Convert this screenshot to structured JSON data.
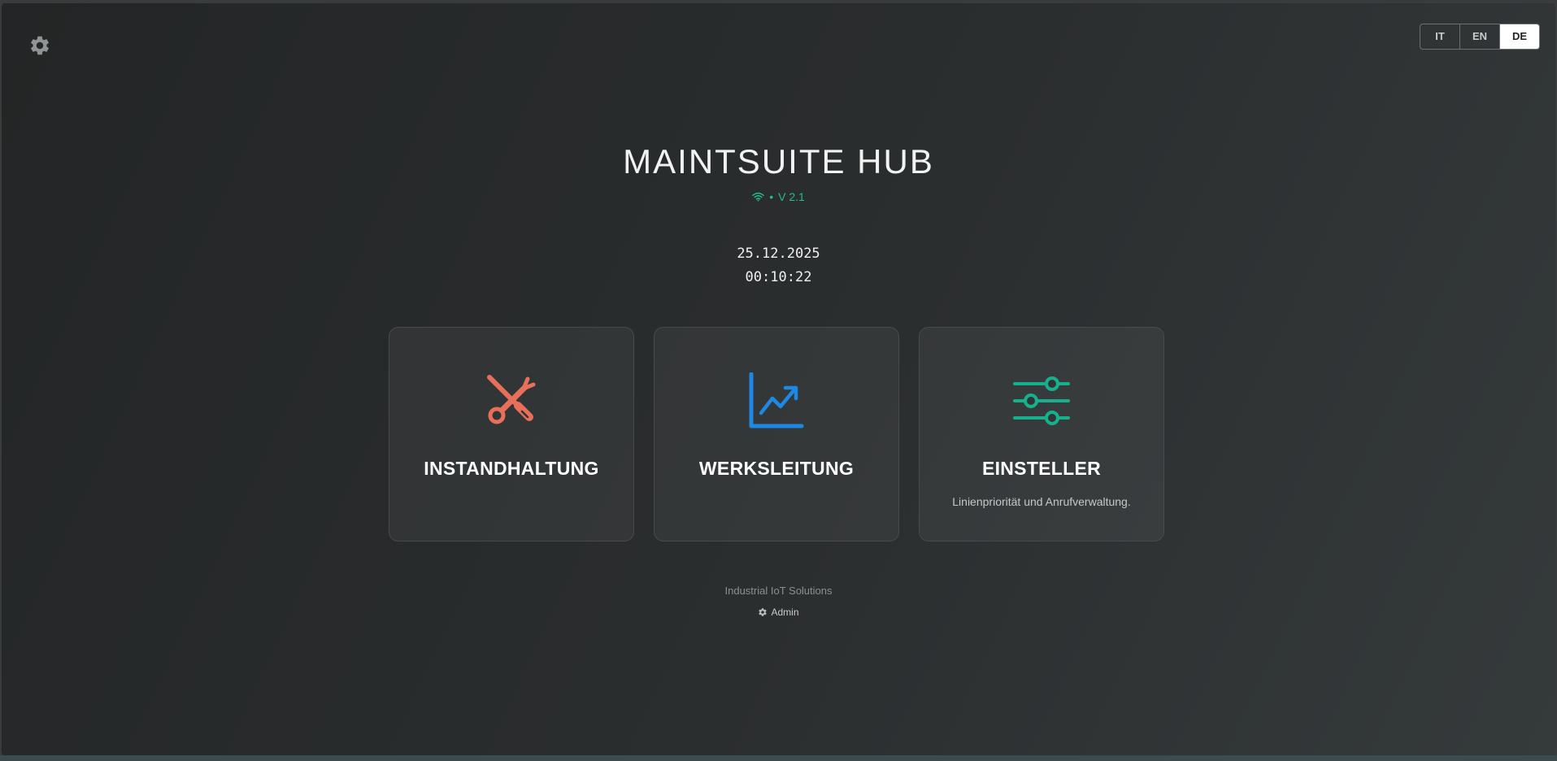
{
  "header": {
    "title": "MAINTSUITE HUB",
    "status_separator": "•",
    "version": "V 2.1"
  },
  "clock": {
    "date": "25.12.2025",
    "time": "00:10:22"
  },
  "language": {
    "options": [
      "IT",
      "EN",
      "DE"
    ],
    "selected": "DE"
  },
  "cards": [
    {
      "title": "INSTANDHALTUNG",
      "description": "",
      "icon": "tools-icon",
      "color": "#e8705a"
    },
    {
      "title": "WERKSLEITUNG",
      "description": "",
      "icon": "chart-line-icon",
      "color": "#1e88e5"
    },
    {
      "title": "EINSTELLER",
      "description": "Linienpriorität und Anrufverwaltung.",
      "icon": "sliders-icon",
      "color": "#16b08c"
    }
  ],
  "footer": {
    "company": "Industrial IoT Solutions",
    "admin_label": "Admin"
  },
  "colors": {
    "accent_green": "#1fbf8f",
    "background": "#262929"
  },
  "icons": {
    "top_left": "gear-icon",
    "status": "wifi-icon",
    "admin": "gear-icon"
  }
}
